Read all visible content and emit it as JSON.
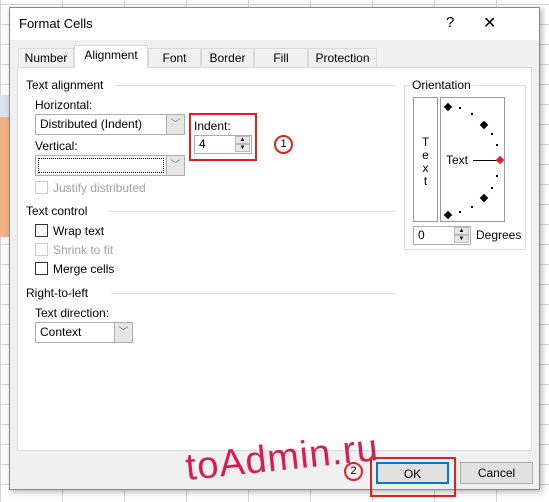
{
  "dialog": {
    "title": "Format Cells",
    "help": "?",
    "close": "✕"
  },
  "tabs": [
    "Number",
    "Alignment",
    "Font",
    "Border",
    "Fill",
    "Protection"
  ],
  "text_alignment": {
    "group": "Text alignment",
    "horizontal_label": "Horizontal:",
    "horizontal_value": "Distributed (Indent)",
    "vertical_label": "Vertical:",
    "vertical_value": "",
    "indent_label": "Indent:",
    "indent_value": "4",
    "justify_label": "Justify distributed"
  },
  "text_control": {
    "group": "Text control",
    "wrap": "Wrap text",
    "shrink": "Shrink to fit",
    "merge": "Merge cells"
  },
  "rtl": {
    "group": "Right-to-left",
    "direction_label": "Text direction:",
    "direction_value": "Context"
  },
  "orientation": {
    "group": "Orientation",
    "vertical_text": [
      "T",
      "e",
      "x",
      "t"
    ],
    "dial_text": "Text",
    "degrees_value": "0",
    "degrees_label": "Degrees"
  },
  "buttons": {
    "ok": "OK",
    "cancel": "Cancel"
  },
  "callouts": [
    "1",
    "2"
  ],
  "watermark": "toAdmin.ru",
  "colors": {
    "highlight": "#e02020",
    "ok_focus": "#0078d7",
    "watermark": "#d81b50"
  }
}
